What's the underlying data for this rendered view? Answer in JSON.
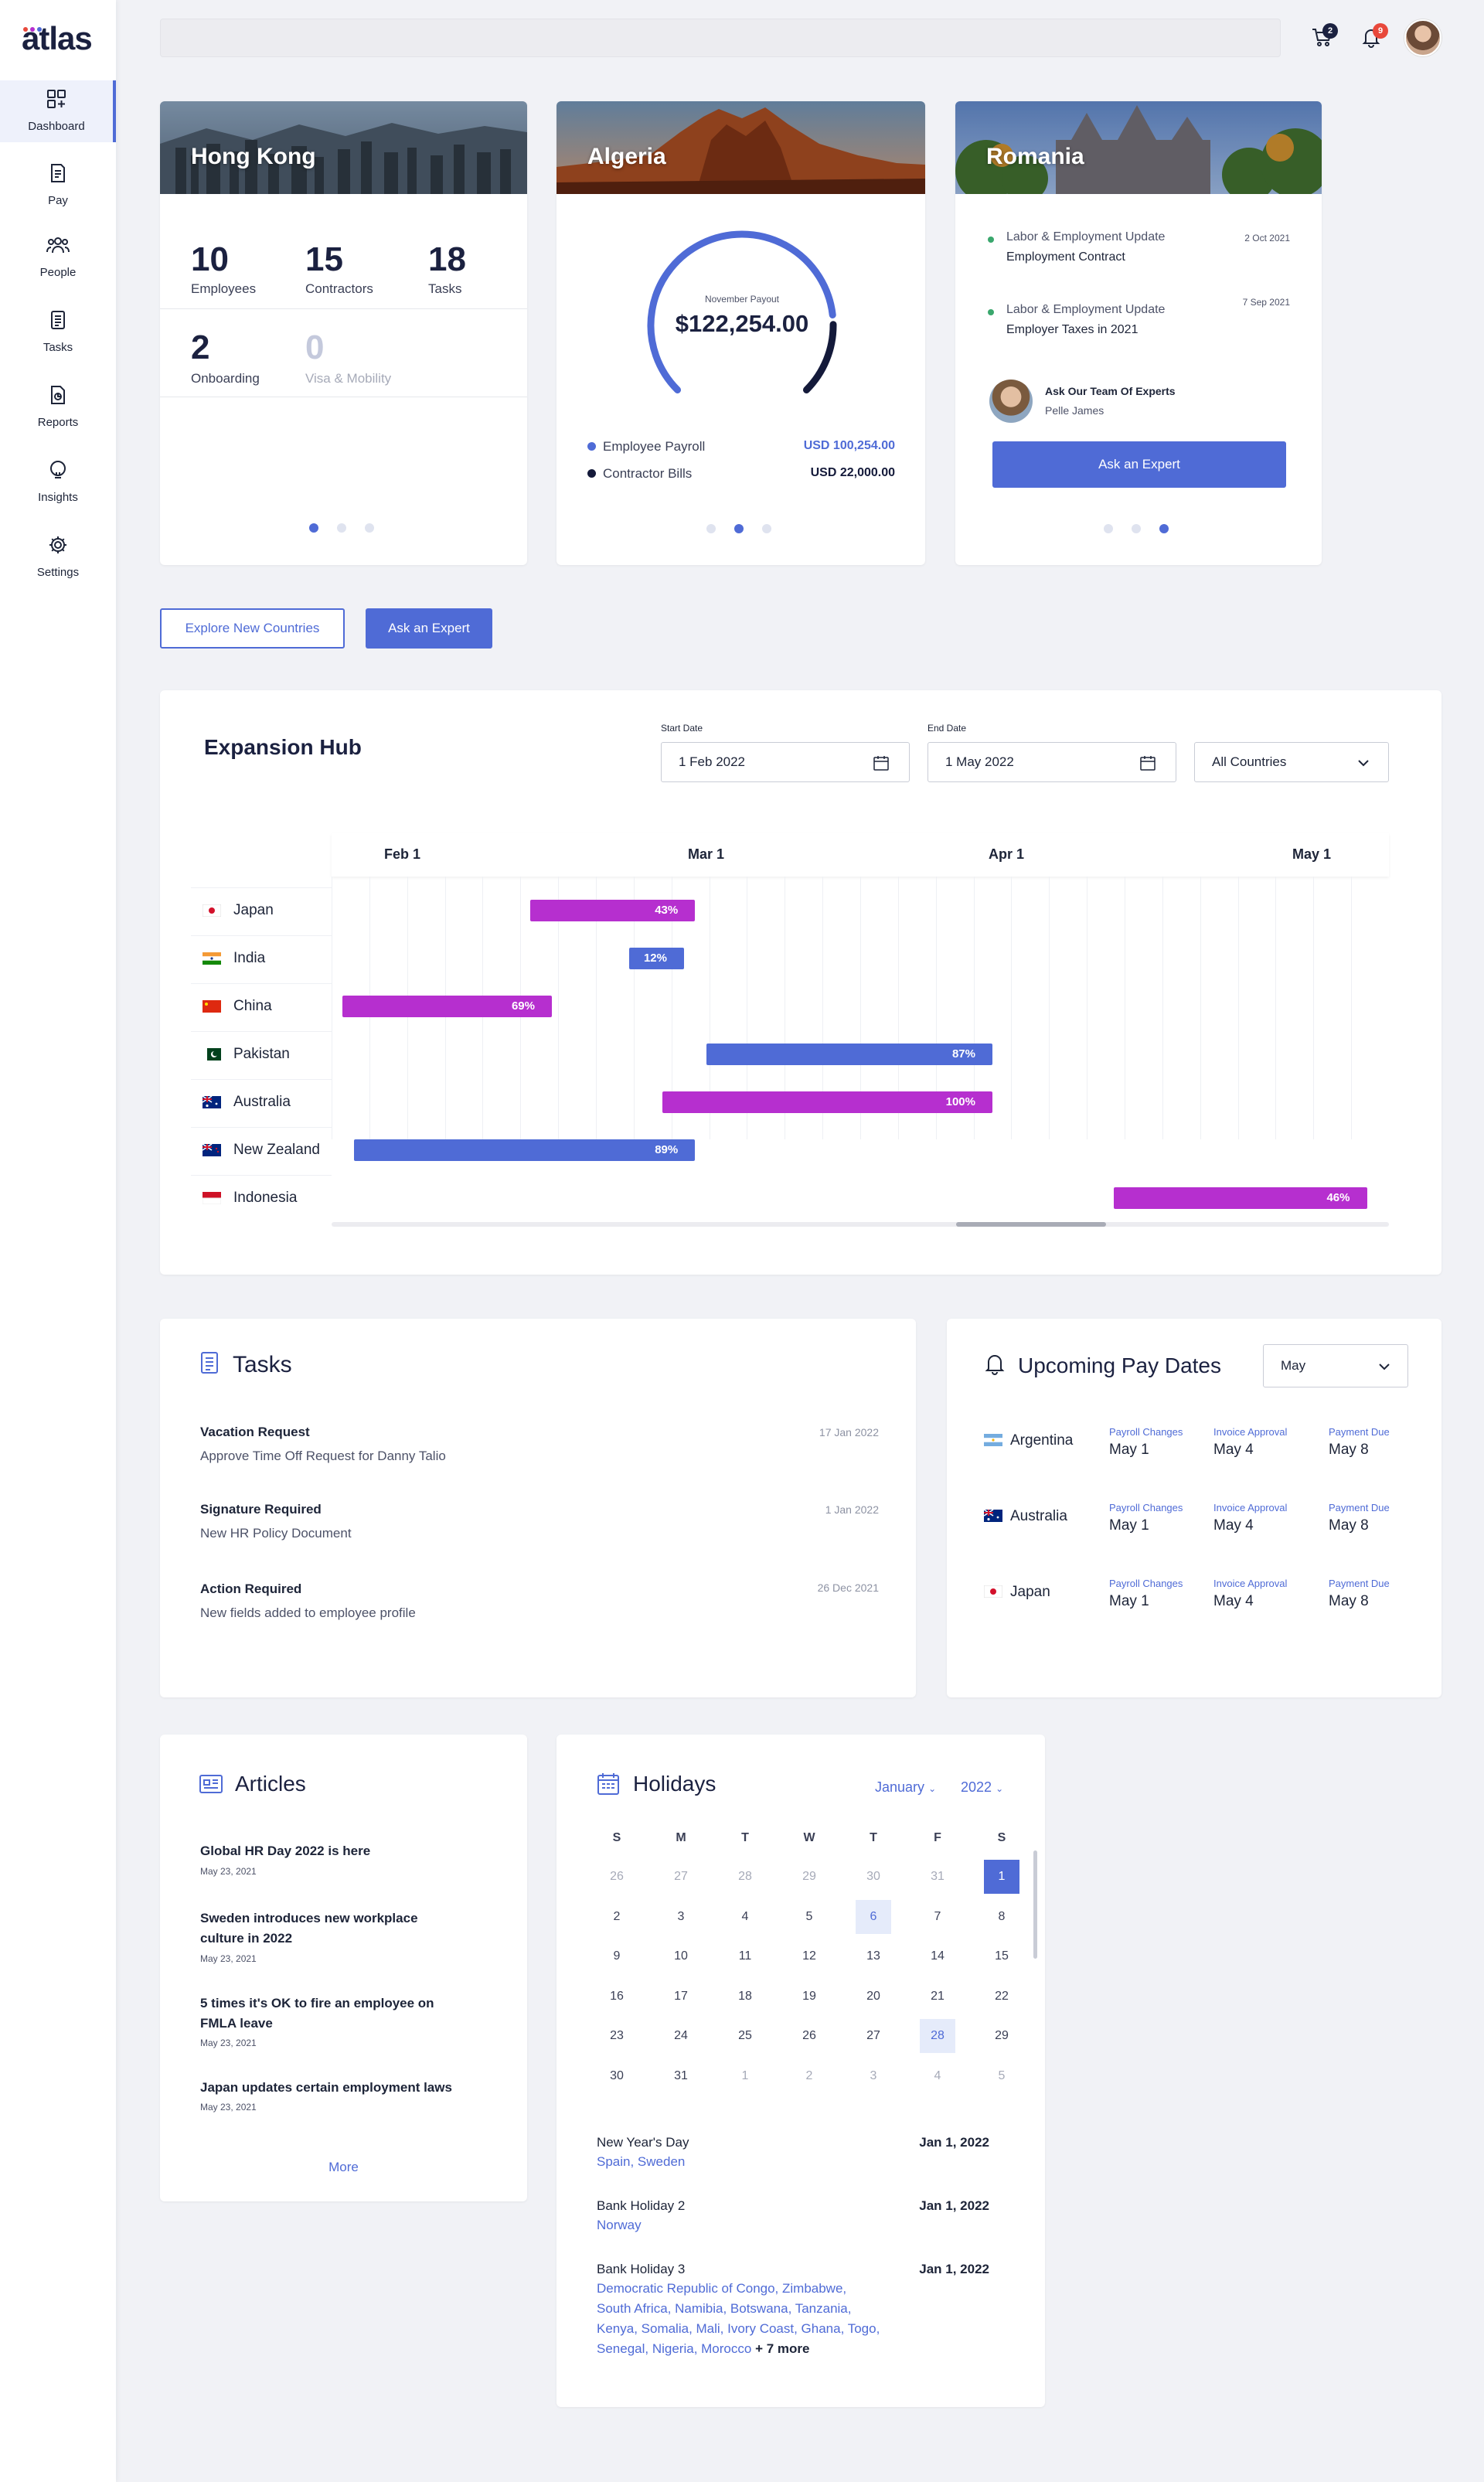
{
  "app": {
    "logo": "atlas"
  },
  "sidebar": {
    "items": [
      {
        "label": "Dashboard",
        "icon": "dashboard-icon",
        "active": true
      },
      {
        "label": "Pay",
        "icon": "pay-icon"
      },
      {
        "label": "People",
        "icon": "people-icon"
      },
      {
        "label": "Tasks",
        "icon": "tasks-icon"
      },
      {
        "label": "Reports",
        "icon": "reports-icon"
      },
      {
        "label": "Insights",
        "icon": "insights-icon"
      },
      {
        "label": "Settings",
        "icon": "settings-icon"
      }
    ]
  },
  "topbar": {
    "cart_count": "2",
    "notification_count": "9"
  },
  "hong_kong": {
    "title": "Hong Kong",
    "stats": [
      {
        "value": "10",
        "label": "Employees"
      },
      {
        "value": "15",
        "label": "Contractors"
      },
      {
        "value": "18",
        "label": "Tasks"
      },
      {
        "value": "2",
        "label": "Onboarding"
      },
      {
        "value": "0",
        "label": "Visa & Mobility"
      }
    ]
  },
  "algeria": {
    "title": "Algeria",
    "payout_label": "November Payout",
    "payout_value": "$122,254.00",
    "gauge": {
      "employee_fraction": 0.82,
      "contractor_fraction": 0.18
    },
    "legend": [
      {
        "label": "Employee Payroll",
        "value": "USD 100,254.00",
        "color": "#4f6bd6"
      },
      {
        "label": "Contractor Bills",
        "value": "USD 22,000.00",
        "color": "#141a3a"
      }
    ]
  },
  "romania": {
    "title": "Romania",
    "updates": [
      {
        "category": "Labor & Employment Update",
        "title": "Employment Contract",
        "date": "2 Oct 2021"
      },
      {
        "category": "Labor & Employment Update",
        "title": "Employer Taxes in 2021",
        "date": "7 Sep 2021"
      }
    ],
    "expert_heading": "Ask Our Team Of Experts",
    "expert_name": "Pelle James",
    "ask_button": "Ask an Expert"
  },
  "actions": {
    "explore": "Explore New Countries",
    "ask": "Ask an Expert"
  },
  "expansion_hub": {
    "title": "Expansion Hub",
    "start_label": "Start Date",
    "start_value": "1 Feb 2022",
    "end_label": "End Date",
    "end_value": "1 May 2022",
    "countries_value": "All Countries",
    "months": [
      "Feb 1",
      "Mar 1",
      "Apr 1",
      "May 1"
    ]
  },
  "chart_data": {
    "type": "gantt",
    "x_range": [
      "2022-02-01",
      "2022-05-08"
    ],
    "categories": [
      "Japan",
      "India",
      "China",
      "Pakistan",
      "Australia",
      "New Zealand",
      "Indonesia"
    ],
    "bars": [
      {
        "country": "Japan",
        "start": "2022-02-19",
        "end": "2022-03-06",
        "progress": "43%",
        "color": "#b62fcf"
      },
      {
        "country": "India",
        "start": "2022-02-28",
        "end": "2022-03-05",
        "progress": "12%",
        "color": "#4f6bd6"
      },
      {
        "country": "China",
        "start": "2022-02-02",
        "end": "2022-02-21",
        "progress": "69%",
        "color": "#b62fcf"
      },
      {
        "country": "Pakistan",
        "start": "2022-03-07",
        "end": "2022-04-02",
        "progress": "87%",
        "color": "#4f6bd6"
      },
      {
        "country": "Australia",
        "start": "2022-03-03",
        "end": "2022-04-02",
        "progress": "100%",
        "color": "#b62fcf"
      },
      {
        "country": "New Zealand",
        "start": "2022-02-03",
        "end": "2022-03-06",
        "progress": "89%",
        "color": "#4f6bd6"
      },
      {
        "country": "Indonesia",
        "start": "2022-04-13",
        "end": "2022-05-06",
        "progress": "46%",
        "color": "#b62fcf"
      }
    ]
  },
  "tasks": {
    "title": "Tasks",
    "items": [
      {
        "title": "Vacation Request",
        "subtitle": "Approve Time Off Request for Danny Talio",
        "date": "17 Jan 2022"
      },
      {
        "title": "Signature Required",
        "subtitle": "New HR Policy Document",
        "date": "1 Jan 2022"
      },
      {
        "title": "Action Required",
        "subtitle": "New fields added to employee profile",
        "date": "26 Dec 2021"
      }
    ]
  },
  "pay_dates": {
    "title": "Upcoming Pay Dates",
    "month_select": "May",
    "columns": [
      "Payroll Changes",
      "Invoice Approval",
      "Payment Due"
    ],
    "rows": [
      {
        "country": "Argentina",
        "values": [
          "May 1",
          "May 4",
          "May 8"
        ]
      },
      {
        "country": "Australia",
        "values": [
          "May 1",
          "May 4",
          "May 8"
        ]
      },
      {
        "country": "Japan",
        "values": [
          "May 1",
          "May 4",
          "May 8"
        ]
      }
    ]
  },
  "articles": {
    "title": "Articles",
    "items": [
      {
        "title": "Global HR Day 2022 is here",
        "date": "May 23, 2021"
      },
      {
        "title": "Sweden introduces new workplace culture in 2022",
        "date": "May 23, 2021"
      },
      {
        "title": "5 times it's OK to fire an employee on FMLA leave",
        "date": "May 23, 2021"
      },
      {
        "title": "Japan updates certain employment laws",
        "date": "May 23, 2021"
      }
    ],
    "more": "More"
  },
  "holidays": {
    "title": "Holidays",
    "month": "January",
    "year": "2022",
    "weekdays": [
      "S",
      "M",
      "T",
      "W",
      "T",
      "F",
      "S"
    ],
    "weeks": [
      [
        "26",
        "27",
        "28",
        "29",
        "30",
        "31",
        "1"
      ],
      [
        "2",
        "3",
        "4",
        "5",
        "6",
        "7",
        "8"
      ],
      [
        "9",
        "10",
        "11",
        "12",
        "13",
        "14",
        "15"
      ],
      [
        "16",
        "17",
        "18",
        "19",
        "20",
        "21",
        "22"
      ],
      [
        "23",
        "24",
        "25",
        "26",
        "27",
        "28",
        "29"
      ],
      [
        "30",
        "31",
        "1",
        "2",
        "3",
        "4",
        "5"
      ]
    ],
    "list": [
      {
        "name": "New Year's Day",
        "date": "Jan 1, 2022",
        "countries": "Spain, Sweden"
      },
      {
        "name": "Bank Holiday 2",
        "date": "Jan 1, 2022",
        "countries": "Norway"
      },
      {
        "name": "Bank Holiday 3",
        "date": "Jan 1, 2022",
        "countries": "Democratic Republic of Congo, Zimbabwe, South Africa, Namibia, Botswana, Tanzania, Kenya, Somalia, Mali, Ivory Coast, Ghana, Togo, Senegal, Nigeria, Morocco",
        "more": "+ 7 more"
      }
    ]
  }
}
